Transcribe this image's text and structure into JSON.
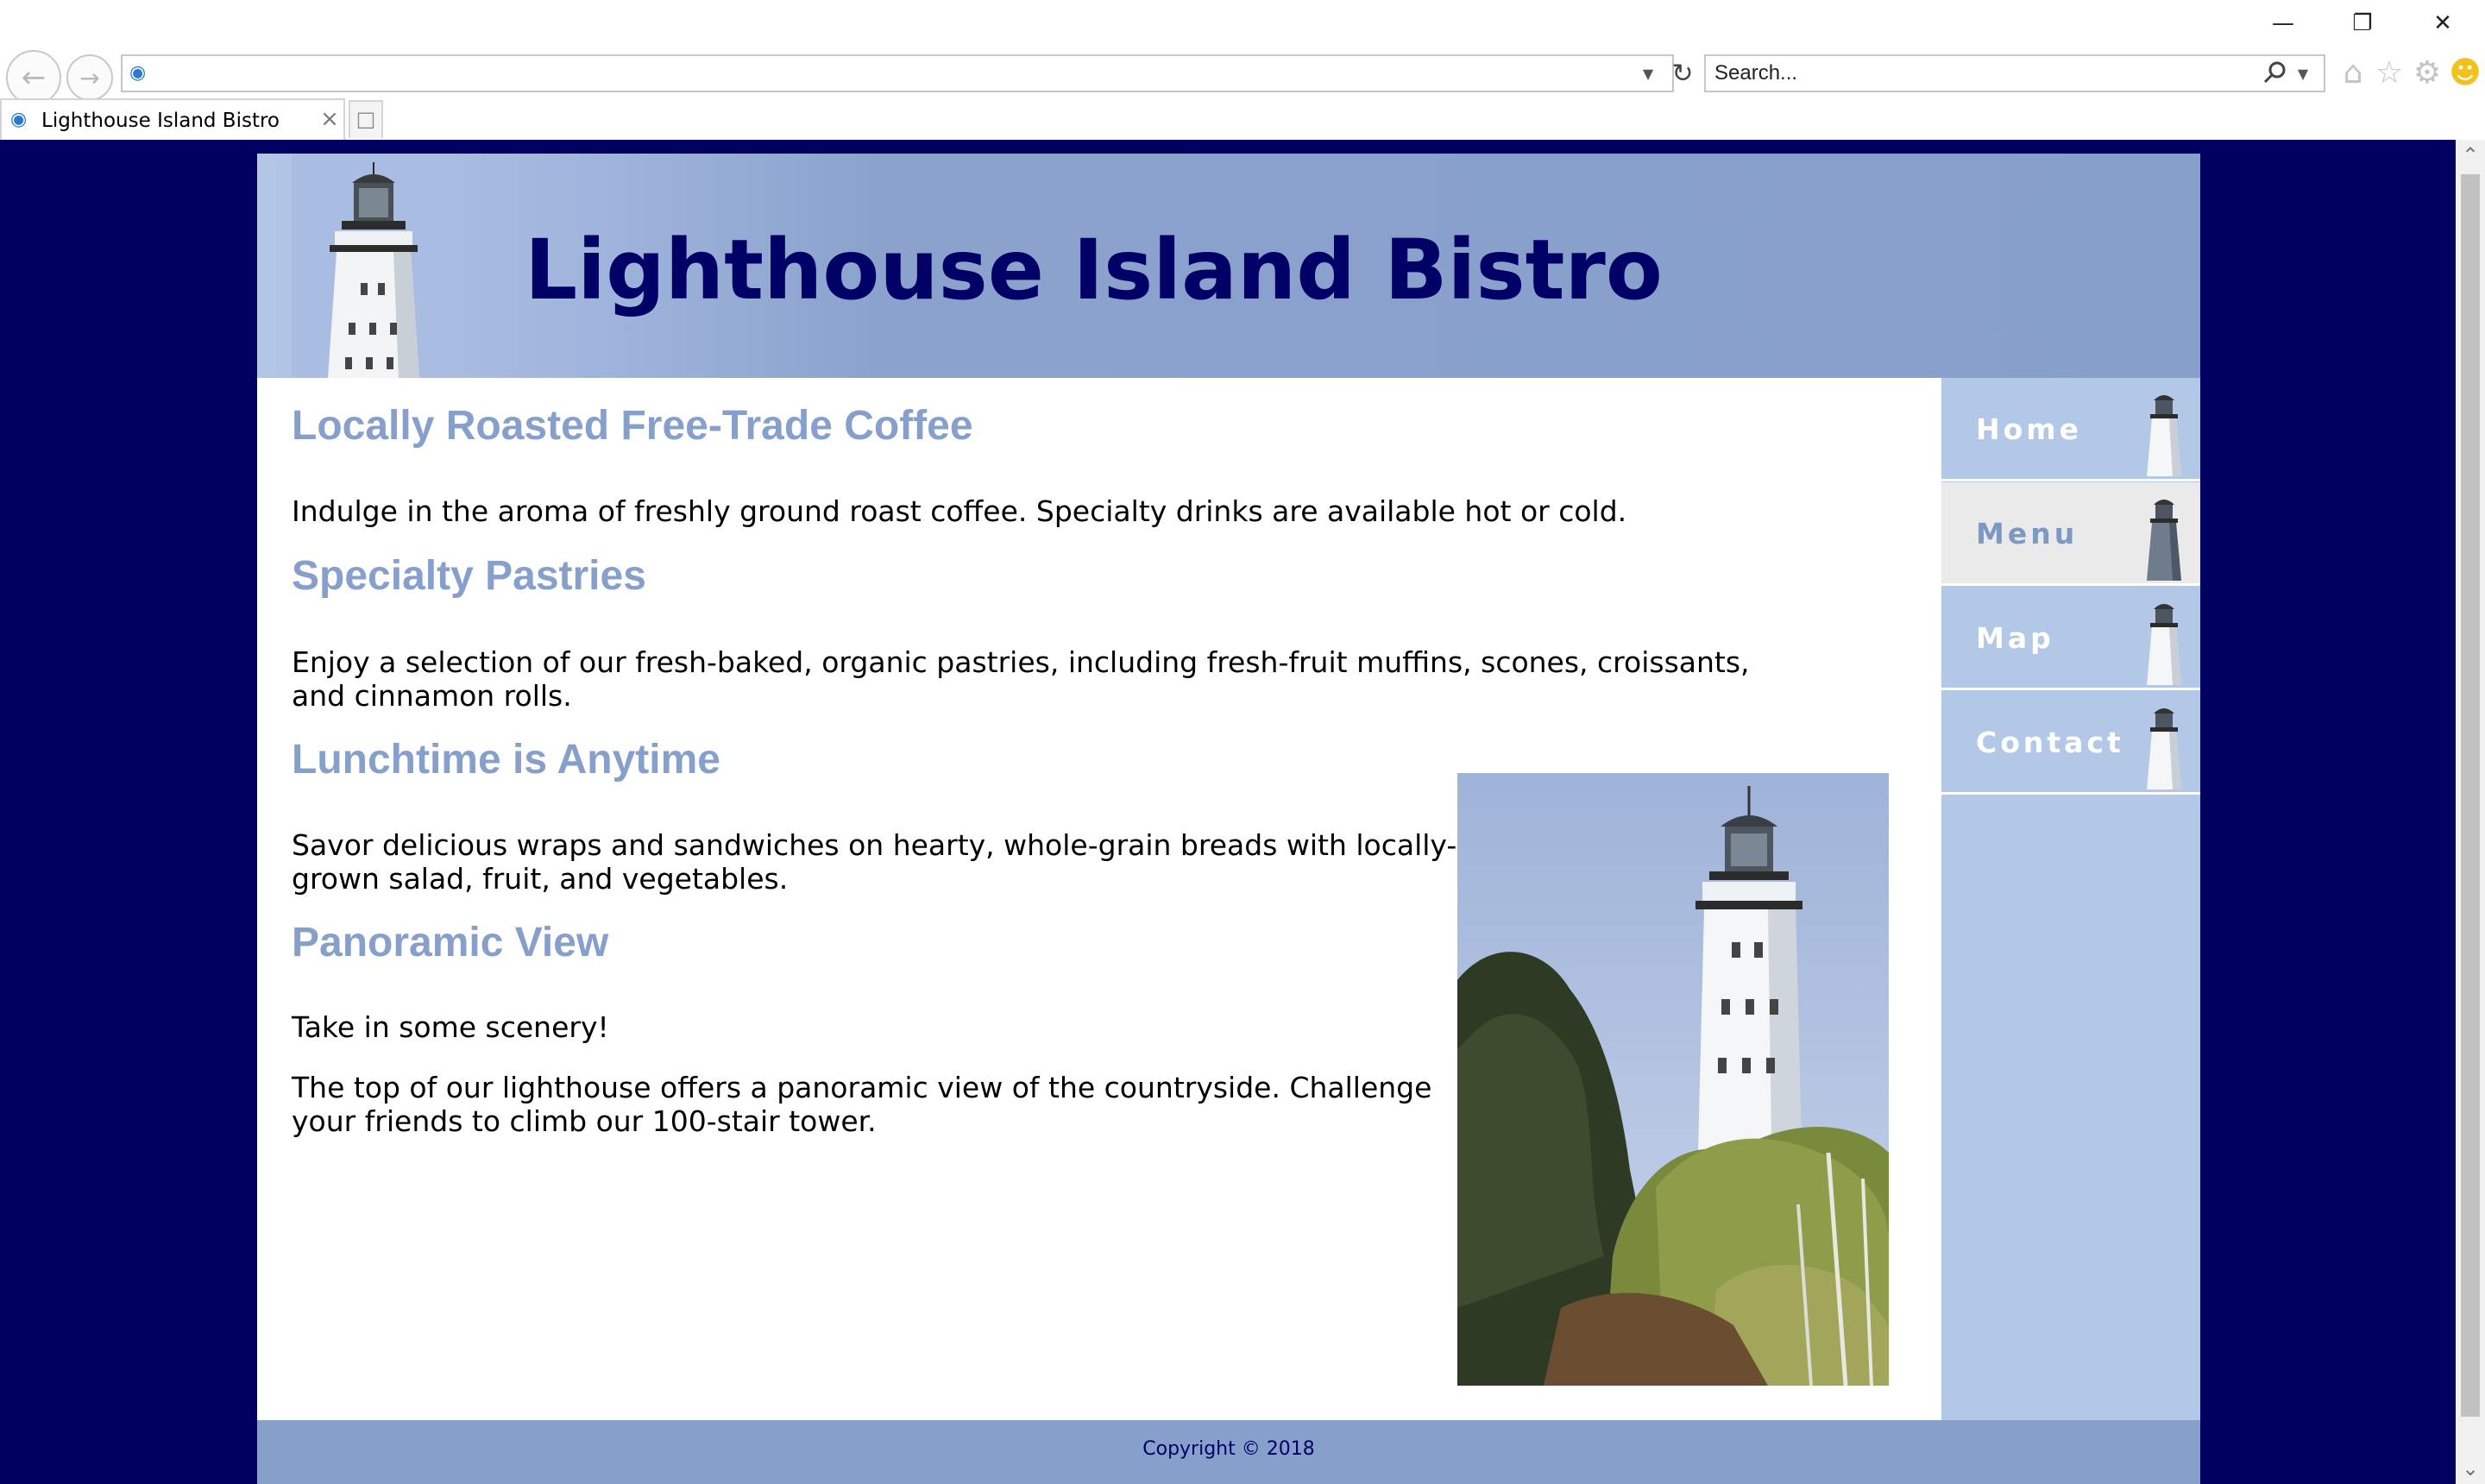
{
  "browser": {
    "window_controls": {
      "minimize": "—",
      "restore": "❐",
      "close": "✕"
    },
    "address_value": "",
    "search_placeholder": "Search...",
    "tab_title": "Lighthouse Island Bistro",
    "icons": [
      "back-icon",
      "forward-icon",
      "ie-icon",
      "dropdown-icon",
      "refresh-icon",
      "search-icon",
      "home-icon",
      "favorites-icon",
      "gear-icon",
      "smiley-icon",
      "close-icon",
      "new-tab-icon"
    ]
  },
  "site": {
    "title": "Lighthouse Island Bistro",
    "colors": {
      "page_background": "#000060",
      "header": "#879fcb",
      "heading": "#869fcb",
      "title": "#000066",
      "sidebar": "#b3c7e7"
    }
  },
  "nav": {
    "items": [
      {
        "label": "Home",
        "current": false
      },
      {
        "label": "Menu",
        "current": true
      },
      {
        "label": "Map",
        "current": false
      },
      {
        "label": "Contact",
        "current": false
      }
    ]
  },
  "content": {
    "sections": [
      {
        "heading": "Locally Roasted Free-Trade Coffee",
        "paragraphs": [
          "Indulge in the aroma of freshly ground roast coffee. Specialty drinks are available hot or cold."
        ]
      },
      {
        "heading": "Specialty Pastries",
        "paragraphs": [
          "Enjoy a selection of our fresh-baked, organic pastries, including fresh-fruit muffins, scones, croissants, and cinnamon rolls."
        ]
      },
      {
        "heading": "Lunchtime is Anytime",
        "paragraphs": [
          "Savor delicious wraps and sandwiches on hearty, whole-grain breads with locally-grown salad, fruit, and vegetables."
        ]
      },
      {
        "heading": "Panoramic View",
        "paragraphs": [
          "Take in some scenery!",
          "The top of our lighthouse offers a panoramic view of the countryside. Challenge your friends to climb our 100-stair tower."
        ]
      }
    ]
  },
  "footer": {
    "copyright": "Copyright © 2018"
  }
}
